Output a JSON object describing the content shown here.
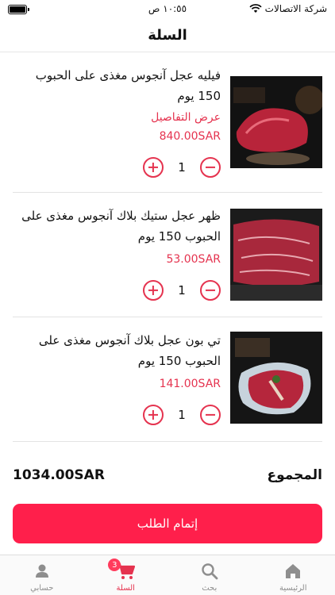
{
  "status_bar": {
    "carrier": "شركة الاتصالات",
    "time": "١٠:٥٥ ص"
  },
  "header": {
    "title": "السلة"
  },
  "cart": {
    "items": [
      {
        "name": "فيليه عجل آنجوس مغذى على الحبوب 150 يوم",
        "details_label": "عرض التفاصيل",
        "price": "840.00SAR",
        "quantity": "1"
      },
      {
        "name": "ظهر عجل ستيك بلاك آنجوس مغذى على الحبوب 150 يوم",
        "price": "53.00SAR",
        "quantity": "1"
      },
      {
        "name": "تي بون عجل بلاك آنجوس مغذى على الحبوب 150 يوم",
        "price": "141.00SAR",
        "quantity": "1"
      }
    ]
  },
  "total": {
    "label": "المجموع",
    "amount": "1034.00SAR"
  },
  "checkout": {
    "label": "إتمام الطلب"
  },
  "tabbar": {
    "tabs": [
      {
        "label": "الرئيسية",
        "icon": "home-icon"
      },
      {
        "label": "بحث",
        "icon": "search-icon"
      },
      {
        "label": "السلة",
        "icon": "cart-icon",
        "badge": "3",
        "active": true
      },
      {
        "label": "حسابي",
        "icon": "profile-icon"
      }
    ]
  },
  "colors": {
    "accent": "#e5334f",
    "button": "#ff1f4b"
  }
}
